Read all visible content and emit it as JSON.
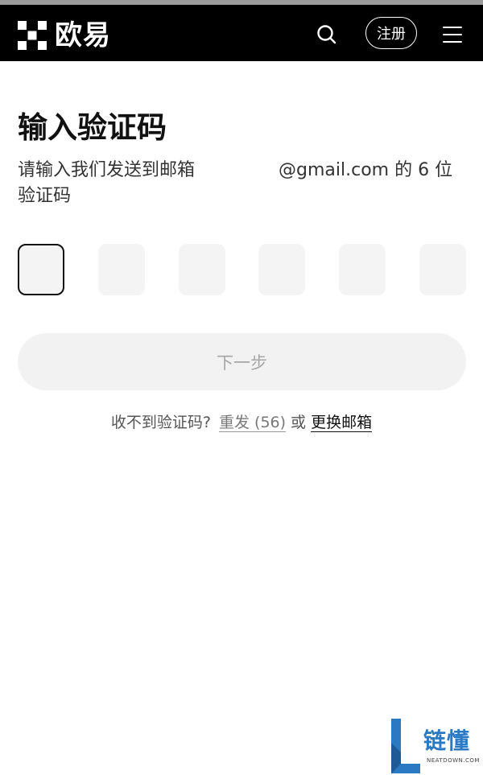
{
  "header": {
    "brand_name": "欧易",
    "register_label": "注册",
    "icons": {
      "logo": "okx-logo-icon",
      "search": "search-icon",
      "menu": "hamburger-menu-icon"
    }
  },
  "page": {
    "title": "输入验证码",
    "description_prefix": "请输入我们发送到邮箱",
    "email_visible_suffix": "@gmail.com",
    "description_suffix": " 的 6 位验证码"
  },
  "code_input": {
    "length": 6,
    "active_index": 0
  },
  "next_button": {
    "label": "下一步",
    "enabled": false
  },
  "helper": {
    "prompt": "收不到验证码?",
    "resend_label": "重发 (56)",
    "or_label": "或",
    "change_email_label": "更换邮箱"
  },
  "watermark": {
    "text": "链懂",
    "subtext": "NEATDOWN.COM"
  },
  "colors": {
    "header_bg": "#000000",
    "accent_blue": "#2b79c2",
    "disabled_bg": "#f2f2f2",
    "disabled_text": "#a6a6a6"
  }
}
